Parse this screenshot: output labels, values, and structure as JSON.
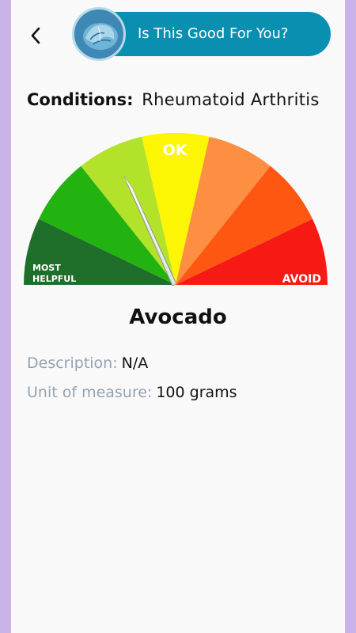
{
  "header": {
    "title": "Is This Good For You?",
    "back_icon": "chevron-left-icon",
    "accent": "#0b8fb0"
  },
  "conditions": {
    "label": "Conditions:",
    "value": "Rheumatoid Arthritis"
  },
  "gauge": {
    "labels": {
      "most_helpful_line1": "MOST",
      "most_helpful_line2": "HELPFUL",
      "ok": "OK",
      "avoid": "AVOID"
    },
    "segment_colors": [
      "#1f6e2a",
      "#23b311",
      "#b2e22a",
      "#fcf503",
      "#fd8e42",
      "#fd5711",
      "#f61914"
    ],
    "needle_position": "between most helpful and ok (slightly helpful)"
  },
  "food": {
    "name": "Avocado",
    "description_label": "Description:",
    "description_value": "N/A",
    "unit_label": "Unit of measure:",
    "unit_value": "100 grams"
  }
}
